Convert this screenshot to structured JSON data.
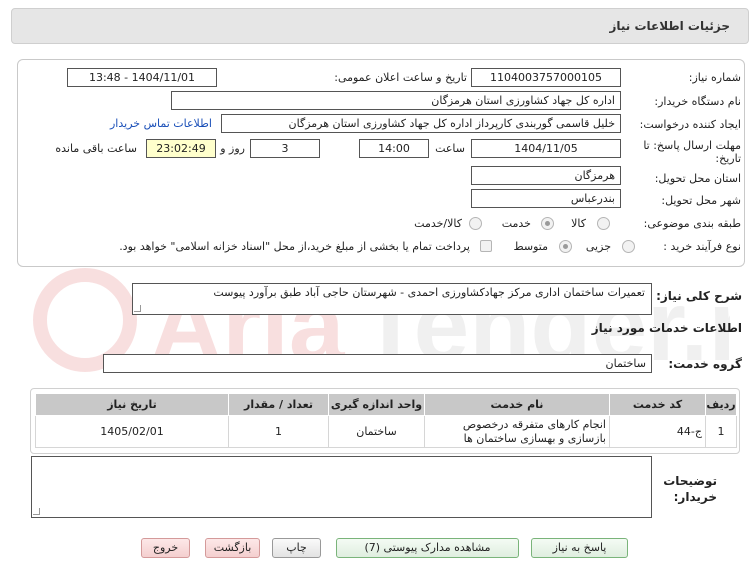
{
  "header": {
    "title": "جزئیات اطلاعات نیاز"
  },
  "watermark": {
    "text": "AriaTender.neT"
  },
  "form": {
    "need_number_label": "شماره نیاز:",
    "need_number": "1104003757000105",
    "announce_label": "تاریخ و ساعت اعلان عمومی:",
    "announce_value": "1404/11/01 - 13:48",
    "buyer_org_label": "نام دستگاه خریدار:",
    "buyer_org": "اداره کل جهاد کشاورزی استان هرمزگان",
    "creator_label": "ایجاد کننده درخواست:",
    "creator": "خلیل قاسمی گوربندی کارپرداز اداره کل جهاد کشاورزی استان هرمزگان",
    "contact_link": "اطلاعات تماس خریدار",
    "deadline_label_1": "مهلت ارسال پاسخ: تا",
    "deadline_label_2": "تاریخ:",
    "deadline_date": "1404/11/05",
    "time_label": "ساعت",
    "deadline_time": "14:00",
    "days_value": "3",
    "days_label": "روز و",
    "remaining_time": "23:02:49",
    "remaining_label": "ساعت باقی مانده",
    "province_label": "استان محل تحویل:",
    "province": "هرمزگان",
    "city_label": "شهر محل تحویل:",
    "city": "بندرعباس",
    "category_label": "طبقه بندی موضوعی:",
    "category_options": [
      "کالا",
      "خدمت",
      "کالا/خدمت"
    ],
    "category_selected": "خدمت",
    "process_label": "نوع فرآیند خرید :",
    "process_options": [
      "جزیی",
      "متوسط"
    ],
    "process_selected": "متوسط",
    "payment_note": "پرداخت تمام یا بخشی از مبلغ خرید،از محل \"اسناد خزانه اسلامی\" خواهد بود."
  },
  "description": {
    "label": "شرح کلی نیاز:",
    "value": "تعمیرات ساختمان اداری مرکز جهادکشاورزی احمدی - شهرستان حاجی آباد طبق برآورد پیوست"
  },
  "services": {
    "section_title": "اطلاعات خدمات مورد نیاز",
    "group_label": "گروه خدمت:",
    "group_value": "ساختمان",
    "columns": [
      "ردیف",
      "کد خدمت",
      "نام خدمت",
      "واحد اندازه گیری",
      "تعداد / مقدار",
      "تاریخ نیاز"
    ],
    "rows": [
      {
        "row": "1",
        "code": "ج-44",
        "name": "انجام کارهای متفرقه درخصوص بازسازی و بهسازی ساختمان ها",
        "unit": "ساختمان",
        "qty": "1",
        "date": "1405/02/01"
      }
    ]
  },
  "notes": {
    "label_1": "توضیحات",
    "label_2": "خریدار:",
    "value": ""
  },
  "buttons": {
    "reply": "پاسخ به نیاز",
    "documents": "مشاهده مدارک پیوستی (7)",
    "print": "چاپ",
    "back": "بازگشت",
    "exit": "خروج"
  }
}
